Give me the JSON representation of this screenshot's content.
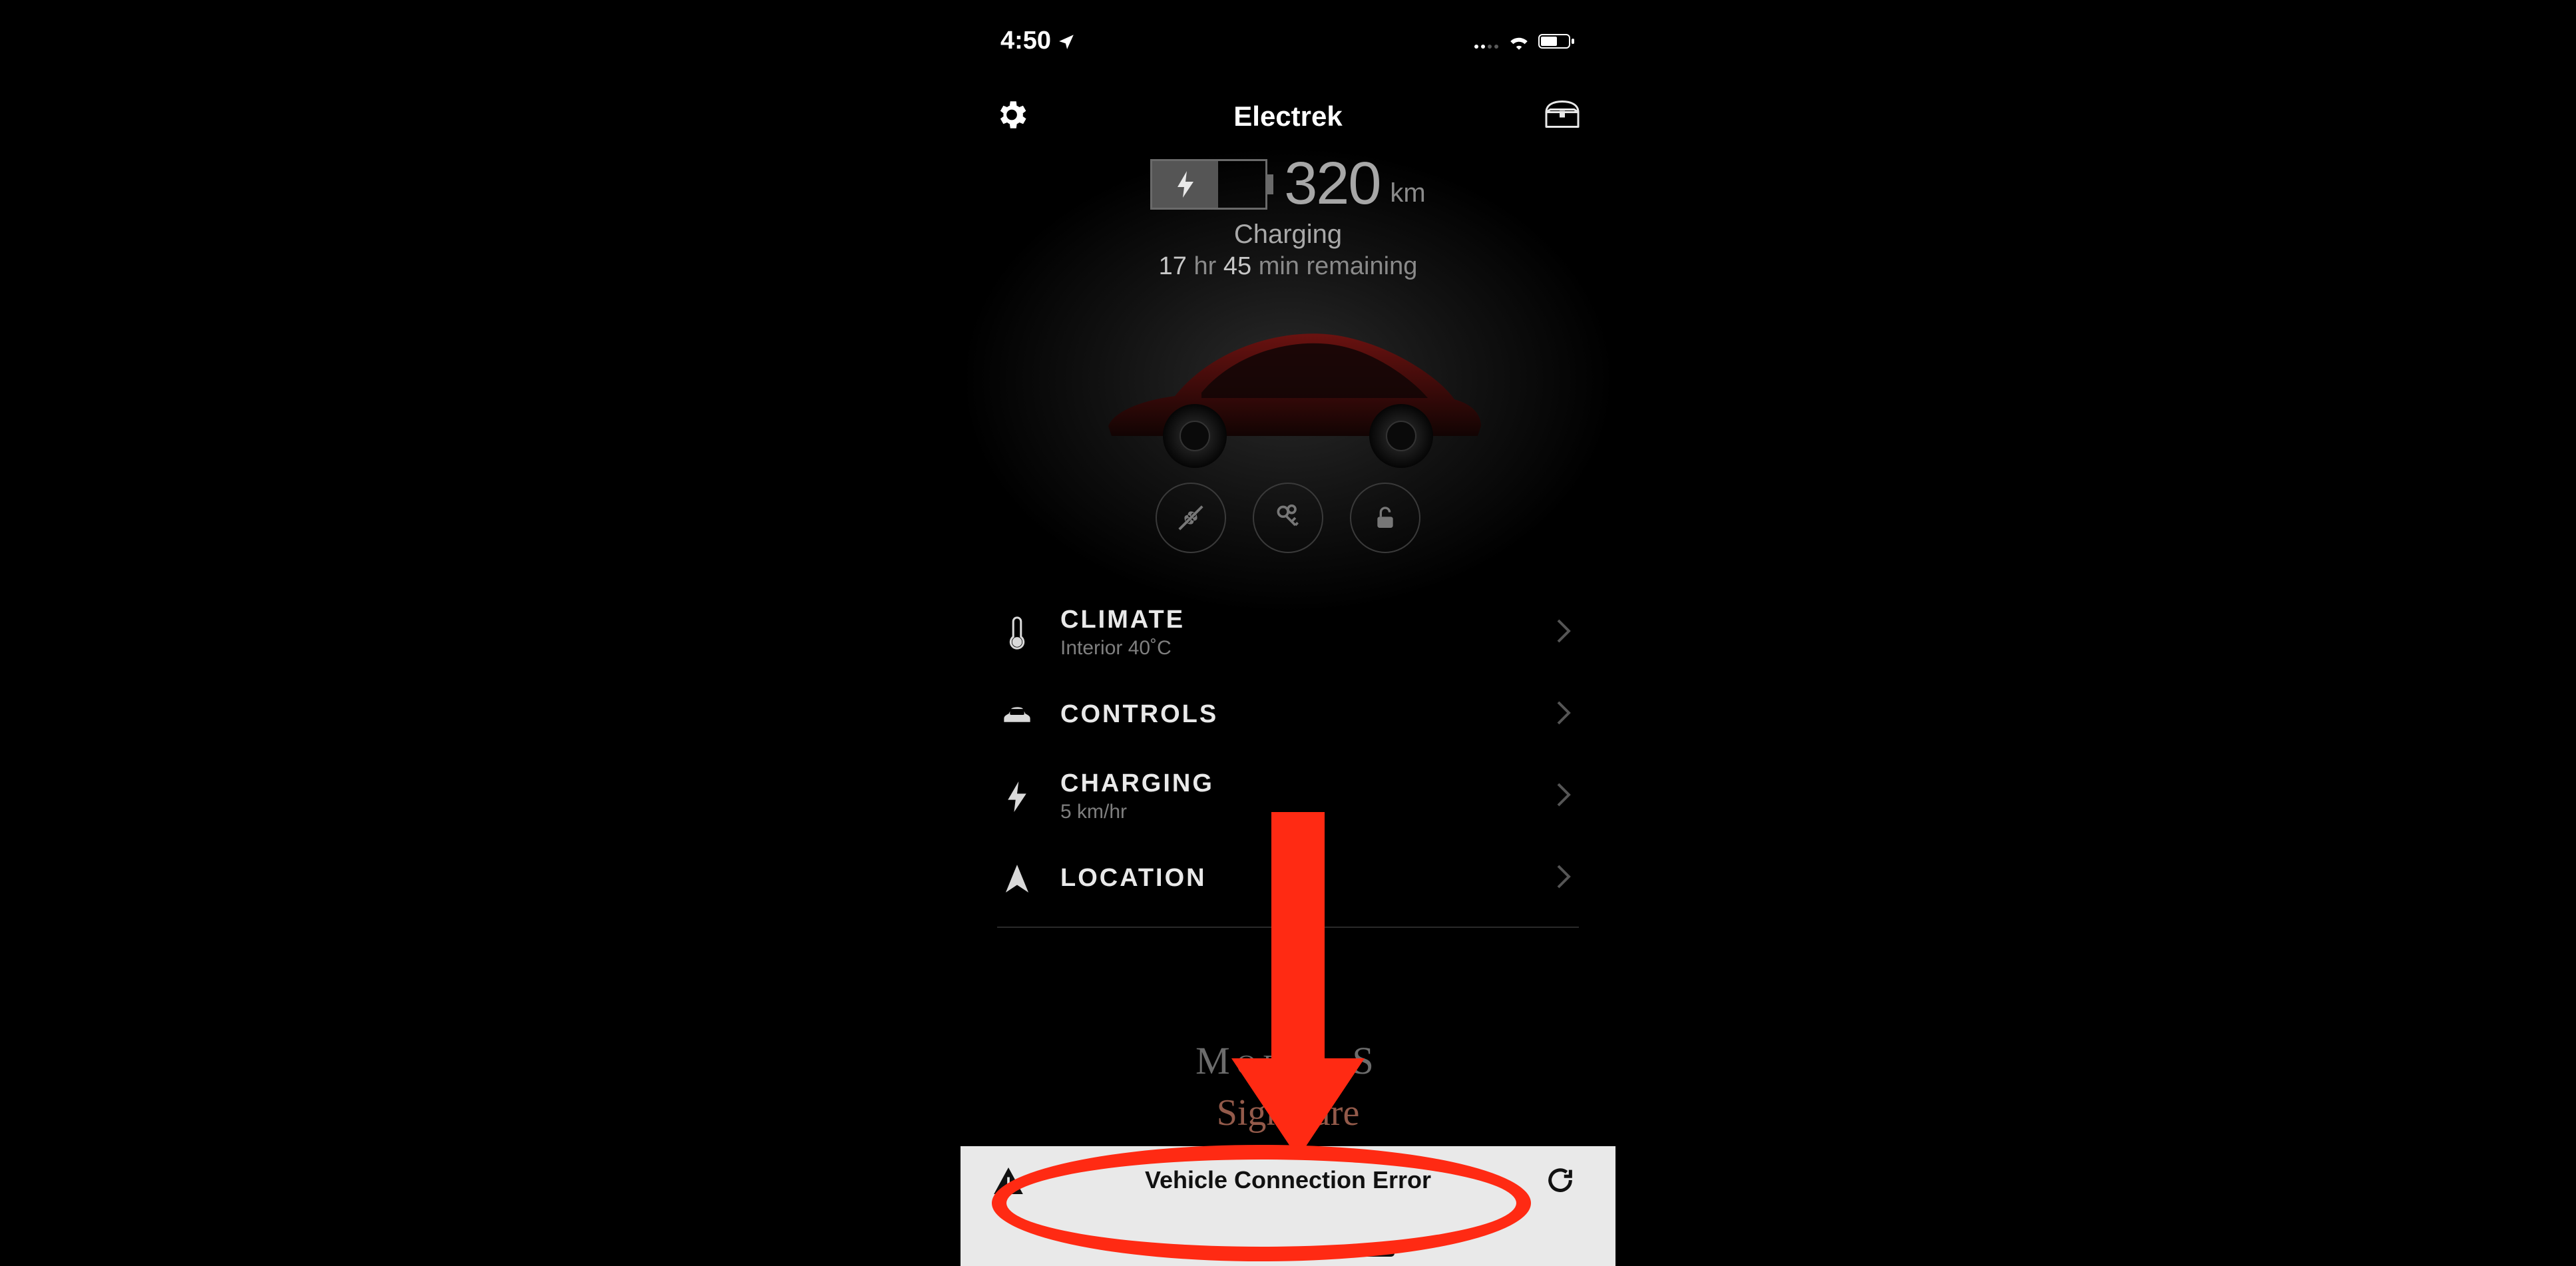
{
  "statusbar": {
    "time": "4:50",
    "location_arrow": "↗"
  },
  "header": {
    "title": "Electrek"
  },
  "range": {
    "value": "320",
    "unit": "km"
  },
  "charging": {
    "label": "Charging",
    "hr_val": "17",
    "hr_label": "hr",
    "min_val": "45",
    "min_label": "min remaining"
  },
  "menu": {
    "climate": {
      "title": "CLIMATE",
      "sub": "Interior 40˚C"
    },
    "controls": {
      "title": "CONTROLS"
    },
    "chargingItem": {
      "title": "CHARGING",
      "sub": "5 km/hr"
    },
    "location": {
      "title": "LOCATION"
    }
  },
  "model": {
    "name": "Model S"
  },
  "footer": {
    "msg": "Vehicle Connection Error"
  }
}
